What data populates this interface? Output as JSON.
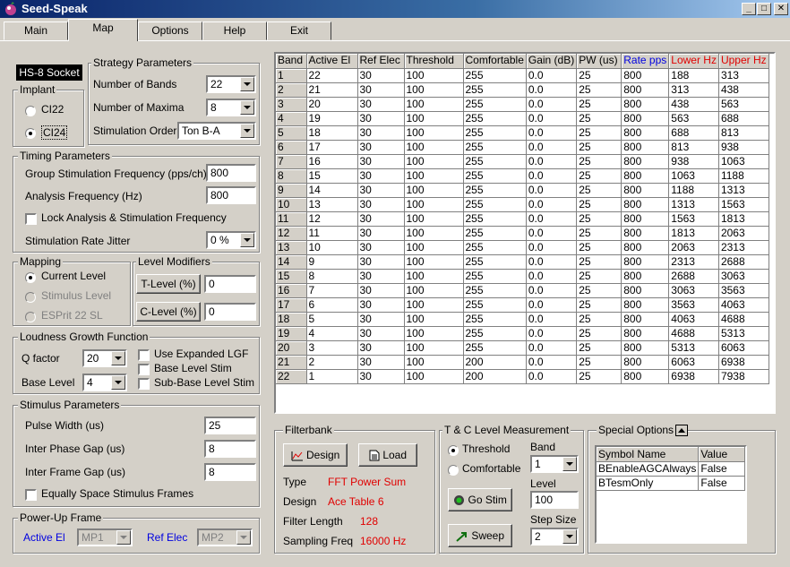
{
  "window": {
    "title": "Seed-Speak"
  },
  "tabs": [
    "Main",
    "Map",
    "Options",
    "Help",
    "Exit"
  ],
  "left": {
    "socket": "HS-8 Socket",
    "implant": {
      "title": "Implant",
      "options": [
        "CI22",
        "CI24"
      ],
      "selected": "CI24"
    },
    "strategy": {
      "title": "Strategy Parameters",
      "bands_label": "Number of Bands",
      "bands_value": "22",
      "maxima_label": "Number of Maxima",
      "maxima_value": "8",
      "order_label": "Stimulation Order",
      "order_value": "Ton B-A"
    },
    "timing": {
      "title": "Timing Parameters",
      "group_label": "Group Stimulation Frequency (pps/ch)",
      "group_value": "800",
      "analysis_label": "Analysis Frequency (Hz)",
      "analysis_value": "800",
      "lock_label": "Lock Analysis & Stimulation Frequency",
      "jitter_label": "Stimulation Rate Jitter",
      "jitter_value": "0 %"
    },
    "mapping": {
      "title": "Mapping",
      "options": [
        "Current Level",
        "Stimulus Level",
        "ESPrit 22 SL"
      ]
    },
    "modifiers": {
      "title": "Level Modifiers",
      "t_label": "T-Level (%)",
      "t_value": "0",
      "c_label": "C-Level (%)",
      "c_value": "0"
    },
    "loudness": {
      "title": "Loudness Growth Function",
      "q_label": "Q factor",
      "q_value": "20",
      "base_label": "Base Level",
      "base_value": "4",
      "checks": [
        "Use Expanded LGF",
        "Base Level Stim",
        "Sub-Base Level Stim"
      ]
    },
    "stimulus": {
      "title": "Stimulus Parameters",
      "pw_label": "Pulse Width (us)",
      "pw_value": "25",
      "ipg_label": "Inter Phase Gap (us)",
      "ipg_value": "8",
      "ifg_label": "Inter Frame Gap (us)",
      "ifg_value": "8",
      "equal_label": "Equally Space Stimulus Frames"
    },
    "powerup": {
      "title": "Power-Up Frame",
      "active_label": "Active El",
      "active_value": "MP1",
      "ref_label": "Ref Elec",
      "ref_value": "MP2"
    }
  },
  "table": {
    "headers": [
      "Band",
      "Active El",
      "Ref Elec",
      "Threshold",
      "Comfortable",
      "Gain (dB)",
      "PW (us)",
      "Rate pps",
      "Lower Hz",
      "Upper Hz"
    ],
    "header_colors": [
      "#000000",
      "#000000",
      "#000000",
      "#000000",
      "#000000",
      "#000000",
      "#000000",
      "#0000e0",
      "#e00000",
      "#e00000"
    ],
    "rows": [
      [
        "1",
        "22",
        "30",
        "100",
        "255",
        "0.0",
        "25",
        "800",
        "188",
        "313"
      ],
      [
        "2",
        "21",
        "30",
        "100",
        "255",
        "0.0",
        "25",
        "800",
        "313",
        "438"
      ],
      [
        "3",
        "20",
        "30",
        "100",
        "255",
        "0.0",
        "25",
        "800",
        "438",
        "563"
      ],
      [
        "4",
        "19",
        "30",
        "100",
        "255",
        "0.0",
        "25",
        "800",
        "563",
        "688"
      ],
      [
        "5",
        "18",
        "30",
        "100",
        "255",
        "0.0",
        "25",
        "800",
        "688",
        "813"
      ],
      [
        "6",
        "17",
        "30",
        "100",
        "255",
        "0.0",
        "25",
        "800",
        "813",
        "938"
      ],
      [
        "7",
        "16",
        "30",
        "100",
        "255",
        "0.0",
        "25",
        "800",
        "938",
        "1063"
      ],
      [
        "8",
        "15",
        "30",
        "100",
        "255",
        "0.0",
        "25",
        "800",
        "1063",
        "1188"
      ],
      [
        "9",
        "14",
        "30",
        "100",
        "255",
        "0.0",
        "25",
        "800",
        "1188",
        "1313"
      ],
      [
        "10",
        "13",
        "30",
        "100",
        "255",
        "0.0",
        "25",
        "800",
        "1313",
        "1563"
      ],
      [
        "11",
        "12",
        "30",
        "100",
        "255",
        "0.0",
        "25",
        "800",
        "1563",
        "1813"
      ],
      [
        "12",
        "11",
        "30",
        "100",
        "255",
        "0.0",
        "25",
        "800",
        "1813",
        "2063"
      ],
      [
        "13",
        "10",
        "30",
        "100",
        "255",
        "0.0",
        "25",
        "800",
        "2063",
        "2313"
      ],
      [
        "14",
        "9",
        "30",
        "100",
        "255",
        "0.0",
        "25",
        "800",
        "2313",
        "2688"
      ],
      [
        "15",
        "8",
        "30",
        "100",
        "255",
        "0.0",
        "25",
        "800",
        "2688",
        "3063"
      ],
      [
        "16",
        "7",
        "30",
        "100",
        "255",
        "0.0",
        "25",
        "800",
        "3063",
        "3563"
      ],
      [
        "17",
        "6",
        "30",
        "100",
        "255",
        "0.0",
        "25",
        "800",
        "3563",
        "4063"
      ],
      [
        "18",
        "5",
        "30",
        "100",
        "255",
        "0.0",
        "25",
        "800",
        "4063",
        "4688"
      ],
      [
        "19",
        "4",
        "30",
        "100",
        "255",
        "0.0",
        "25",
        "800",
        "4688",
        "5313"
      ],
      [
        "20",
        "3",
        "30",
        "100",
        "255",
        "0.0",
        "25",
        "800",
        "5313",
        "6063"
      ],
      [
        "21",
        "2",
        "30",
        "100",
        "200",
        "0.0",
        "25",
        "800",
        "6063",
        "6938"
      ],
      [
        "22",
        "1",
        "30",
        "100",
        "200",
        "0.0",
        "25",
        "800",
        "6938",
        "7938"
      ]
    ]
  },
  "filterbank": {
    "title": "Filterbank",
    "design_btn": "Design",
    "load_btn": "Load",
    "type_label": "Type",
    "type_value": "FFT Power Sum",
    "design_label": "Design",
    "design_value": "Ace Table 6",
    "length_label": "Filter Length",
    "length_value": "128",
    "sampling_label": "Sampling Freq",
    "sampling_value": "16000 Hz"
  },
  "tc": {
    "title": "T & C Level Measurement",
    "options": [
      "Threshold",
      "Comfortable"
    ],
    "band_label": "Band",
    "band_value": "1",
    "level_label": "Level",
    "level_value": "100",
    "go_btn": "Go Stim",
    "sweep_btn": "Sweep",
    "step_label": "Step Size",
    "step_value": "2"
  },
  "special": {
    "title": "Special Options",
    "headers": [
      "Symbol Name",
      "Value"
    ],
    "rows": [
      [
        "BEnableAGCAlways",
        "False"
      ],
      [
        "BTesmOnly",
        "False"
      ]
    ]
  }
}
